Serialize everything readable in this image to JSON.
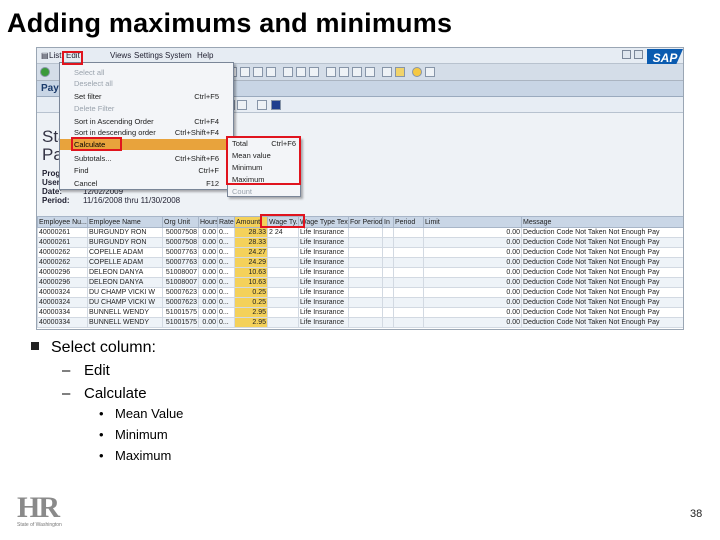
{
  "slide": {
    "title": "Adding maximums and minimums",
    "page_number": "38",
    "logo_text": "HR",
    "logo_subtext": "State of Washington"
  },
  "sap": {
    "menu": [
      "List",
      "Edit",
      "Views",
      "Settings",
      "System",
      "Help"
    ],
    "logo": "SAP",
    "window_title": "Payr",
    "report_title_line1": "Sta",
    "report_title_line2": "Pay",
    "header_labels": [
      "Progr",
      "User:",
      "Date:",
      "Period:"
    ],
    "header_values": [
      "",
      "",
      "12/02/2009",
      "11/16/2008 thru 11/30/2008"
    ],
    "edit_menu": [
      {
        "label": "Select all",
        "shortcut": "",
        "disabled": true
      },
      {
        "label": "Deselect all",
        "shortcut": "",
        "disabled": true
      },
      {
        "label": "Set filter",
        "shortcut": "Ctrl+F5",
        "disabled": false
      },
      {
        "label": "Delete Filter",
        "shortcut": "",
        "disabled": true
      },
      {
        "label": "Sort in Ascending Order",
        "shortcut": "Ctrl+F4",
        "disabled": false
      },
      {
        "label": "Sort in descending order",
        "shortcut": "Ctrl+Shift+F4",
        "disabled": false
      },
      {
        "label": "Calculate",
        "shortcut": "",
        "disabled": false,
        "highlighted": true
      },
      {
        "label": "Subtotals...",
        "shortcut": "Ctrl+Shift+F6",
        "disabled": false
      },
      {
        "label": "Find",
        "shortcut": "Ctrl+F",
        "disabled": false
      },
      {
        "label": "Cancel",
        "shortcut": "F12",
        "disabled": false
      }
    ],
    "calculate_submenu": [
      {
        "label": "Total",
        "shortcut": "Ctrl+F6",
        "disabled": false
      },
      {
        "label": "Mean value",
        "shortcut": "",
        "disabled": false
      },
      {
        "label": "Minimum",
        "shortcut": "",
        "disabled": false
      },
      {
        "label": "Maximum",
        "shortcut": "",
        "disabled": false
      },
      {
        "label": "Count",
        "shortcut": "",
        "disabled": true
      }
    ],
    "grid": {
      "columns": [
        "Employee Nu...",
        "Employee Name",
        "Org Unit",
        "Hours",
        "Rate",
        "Amount",
        "Wage Ty...",
        "Wage Type Text",
        "For Period",
        "In",
        "Period",
        "Limit",
        "Message"
      ],
      "rows": [
        [
          "40000261",
          "BURGUNDY RON",
          "50007508",
          "0.00",
          "0...",
          "28.33",
          "2 24",
          "Life Insurance",
          "",
          "",
          "",
          "0.00",
          "Deduction Code Not Taken Not Enough Pay"
        ],
        [
          "40000261",
          "BURGUNDY RON",
          "50007508",
          "0.00",
          "0...",
          "28.33",
          "",
          "Life Insurance",
          "",
          "",
          "",
          "0.00",
          "Deduction Code Not Taken Not Enough Pay"
        ],
        [
          "40000262",
          "COPELLE ADAM",
          "50007763",
          "0.00",
          "0...",
          "24.27",
          "",
          "Life Insurance",
          "",
          "",
          "",
          "0.00",
          "Deduction Code Not Taken Not Enough Pay"
        ],
        [
          "40000262",
          "COPELLE ADAM",
          "50007763",
          "0.00",
          "0...",
          "24.29",
          "",
          "Life Insurance",
          "",
          "",
          "",
          "0.00",
          "Deduction Code Not Taken Not Enough Pay"
        ],
        [
          "40000296",
          "DELEON DANYA",
          "51008007",
          "0.00",
          "0...",
          "10.63",
          "",
          "Life Insurance",
          "",
          "",
          "",
          "0.00",
          "Deduction Code Not Taken Not Enough Pay"
        ],
        [
          "40000296",
          "DELEON DANYA",
          "51008007",
          "0.00",
          "0...",
          "10.63",
          "",
          "Life Insurance",
          "",
          "",
          "",
          "0.00",
          "Deduction Code Not Taken Not Enough Pay"
        ],
        [
          "40000324",
          "DU CHAMP VICKI W",
          "50007623",
          "0.00",
          "0...",
          "0.25",
          "",
          "Life Insurance",
          "",
          "",
          "",
          "0.00",
          "Deduction Code Not Taken Not Enough Pay"
        ],
        [
          "40000324",
          "DU CHAMP VICKI W",
          "50007623",
          "0.00",
          "0...",
          "0.25",
          "",
          "Life Insurance",
          "",
          "",
          "",
          "0.00",
          "Deduction Code Not Taken Not Enough Pay"
        ],
        [
          "40000334",
          "BUNNELL WENDY",
          "51001575",
          "0.00",
          "0...",
          "2.95",
          "",
          "Life Insurance",
          "",
          "",
          "",
          "0.00",
          "Deduction Code Not Taken Not Enough Pay"
        ],
        [
          "40000334",
          "BUNNELL WENDY",
          "51001575",
          "0.00",
          "0...",
          "2.95",
          "",
          "Life Insurance",
          "",
          "",
          "",
          "0.00",
          "Deduction Code Not Taken Not Enough Pay"
        ]
      ]
    }
  },
  "bullets": {
    "main": "Select column:",
    "level2": [
      "Edit",
      "Calculate"
    ],
    "level3": [
      "Mean Value",
      "Minimum",
      "Maximum"
    ]
  }
}
